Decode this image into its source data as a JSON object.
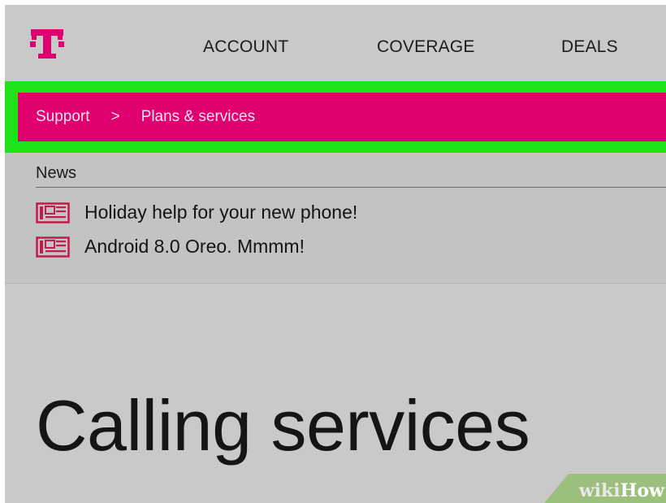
{
  "nav": {
    "logo": "T",
    "items": [
      {
        "label": "ACCOUNT"
      },
      {
        "label": "COVERAGE"
      },
      {
        "label": "DEALS"
      }
    ]
  },
  "breadcrumb": {
    "items": [
      {
        "label": "Support"
      },
      {
        "label": "Plans & services"
      }
    ],
    "separator": ">"
  },
  "news": {
    "title": "News",
    "items": [
      {
        "label": "Holiday help for your new phone!",
        "icon": "newspaper-icon"
      },
      {
        "label": "Android 8.0 Oreo. Mmmm!",
        "icon": "newspaper-icon"
      }
    ]
  },
  "main": {
    "heading": "Calling services"
  },
  "watermark": {
    "wiki": "wiki",
    "how": "How"
  },
  "colors": {
    "brand_magenta": "#e0006f",
    "highlight_green": "#1ee31a",
    "background_gray": "#c9c9c9"
  }
}
